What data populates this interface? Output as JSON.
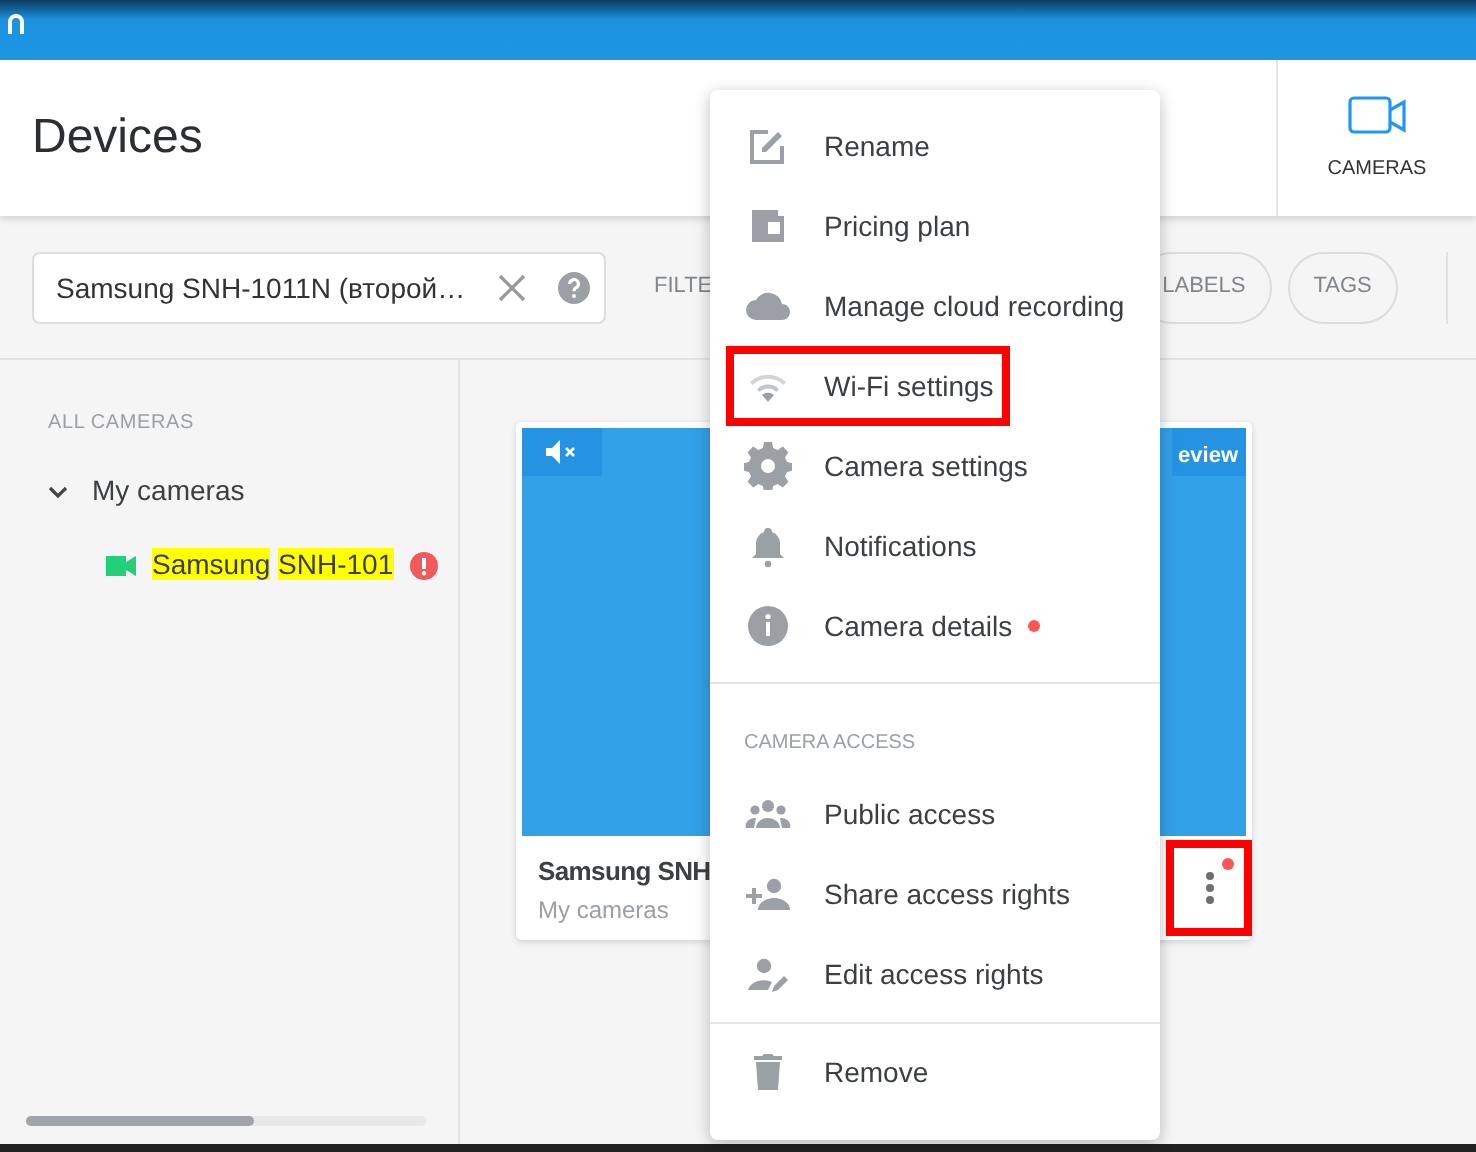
{
  "page": {
    "title": "Devices"
  },
  "nav": [
    {
      "label": "CAMERAS",
      "kind": "camera",
      "selected": true
    }
  ],
  "search": {
    "value": "Samsung SNH-1011N (второй…"
  },
  "filters": [
    {
      "label": "FILTE",
      "kind": "text"
    },
    {
      "label": "LABELS",
      "kind": "chip"
    },
    {
      "label": "TAGS",
      "kind": "chip"
    }
  ],
  "sidebar": {
    "heading": "ALL CAMERAS",
    "groups": [
      {
        "label": "My cameras",
        "expanded": true,
        "children": [
          {
            "words": [
              {
                "text": "Samsung",
                "highlighted": true
              },
              {
                "text": "SNH-101",
                "highlighted": true
              }
            ],
            "online": true,
            "alert": true
          }
        ]
      }
    ]
  },
  "camera_card": {
    "name": "Samsung SNH",
    "group": "My cameras",
    "muted": true,
    "preview_label": "eview",
    "menu_alert": true,
    "menu_highlighted": true
  },
  "menu": {
    "sections": [
      {
        "items": [
          {
            "label": "Rename",
            "kind": "edit",
            "alert": false,
            "highlighted": false
          },
          {
            "label": "Pricing plan",
            "kind": "wallet",
            "alert": false,
            "highlighted": false
          },
          {
            "label": "Manage cloud recording",
            "kind": "cloud",
            "alert": false,
            "highlighted": false
          },
          {
            "label": "Wi-Fi settings",
            "kind": "wifi",
            "alert": false,
            "highlighted": true
          },
          {
            "label": "Camera settings",
            "kind": "gear",
            "alert": false,
            "highlighted": false
          },
          {
            "label": "Notifications",
            "kind": "bell",
            "alert": false,
            "highlighted": false
          },
          {
            "label": "Camera details",
            "kind": "info",
            "alert": true,
            "highlighted": false
          }
        ]
      },
      {
        "header": "CAMERA ACCESS",
        "items": [
          {
            "label": "Public access",
            "kind": "group",
            "alert": false,
            "highlighted": false
          },
          {
            "label": "Share access rights",
            "kind": "person-add",
            "alert": false,
            "highlighted": false
          },
          {
            "label": "Edit access rights",
            "kind": "person-edit",
            "alert": false,
            "highlighted": false
          }
        ]
      },
      {
        "items": [
          {
            "label": "Remove",
            "kind": "trash",
            "alert": false,
            "highlighted": false
          }
        ]
      }
    ]
  }
}
